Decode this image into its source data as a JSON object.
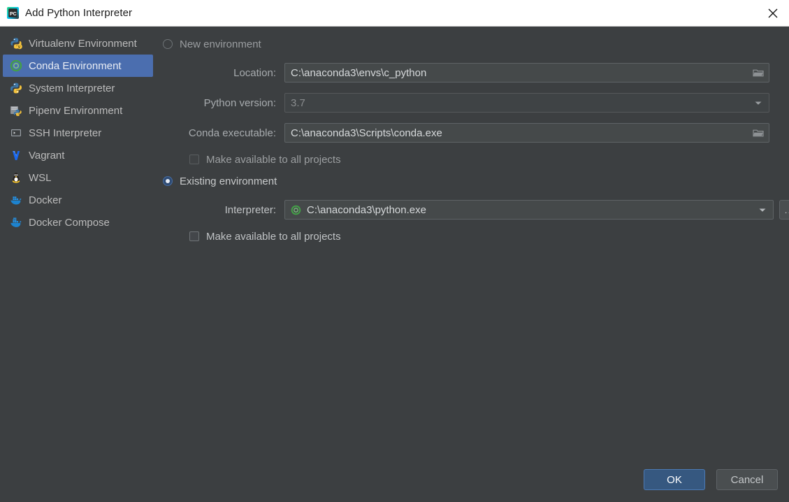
{
  "window": {
    "title": "Add Python Interpreter",
    "app_icon": "pycharm-icon",
    "close_icon": "close-icon",
    "background_color": "#3c3f41",
    "titlebar_color": "#ffffff",
    "accent_color": "#4b6eaf"
  },
  "sidebar": {
    "items": [
      {
        "label": "Virtualenv Environment",
        "icon": "python-virtualenv-icon",
        "selected": false
      },
      {
        "label": "Conda Environment",
        "icon": "conda-icon",
        "selected": true
      },
      {
        "label": "System Interpreter",
        "icon": "python-icon",
        "selected": false
      },
      {
        "label": "Pipenv Environment",
        "icon": "pipenv-icon",
        "selected": false
      },
      {
        "label": "SSH Interpreter",
        "icon": "ssh-terminal-icon",
        "selected": false
      },
      {
        "label": "Vagrant",
        "icon": "vagrant-icon",
        "selected": false
      },
      {
        "label": "WSL",
        "icon": "linux-penguin-icon",
        "selected": false
      },
      {
        "label": "Docker",
        "icon": "docker-whale-icon",
        "selected": false
      },
      {
        "label": "Docker Compose",
        "icon": "docker-compose-icon",
        "selected": false
      }
    ]
  },
  "main": {
    "new_environment": {
      "label": "New environment",
      "selected": false,
      "location": {
        "label": "Location:",
        "value": "C:\\anaconda3\\envs\\c_python",
        "browse_icon": "folder-icon"
      },
      "python_version": {
        "label": "Python version:",
        "value": "3.7",
        "dropdown_icon": "chevron-down-icon",
        "disabled": true
      },
      "conda_executable": {
        "label": "Conda executable:",
        "value": "C:\\anaconda3\\Scripts\\conda.exe",
        "browse_icon": "folder-icon"
      },
      "make_available": {
        "label": "Make available to all projects",
        "checked": false,
        "disabled": true
      }
    },
    "existing_environment": {
      "label": "Existing environment",
      "selected": true,
      "interpreter": {
        "label": "Interpreter:",
        "value": "C:\\anaconda3\\python.exe",
        "item_icon": "conda-icon",
        "dropdown_icon": "chevron-down-icon",
        "browse_label": "...",
        "browse_name": "ellipsis-button"
      },
      "make_available": {
        "label": "Make available to all projects",
        "checked": false,
        "disabled": false
      }
    }
  },
  "footer": {
    "ok_label": "OK",
    "cancel_label": "Cancel"
  }
}
